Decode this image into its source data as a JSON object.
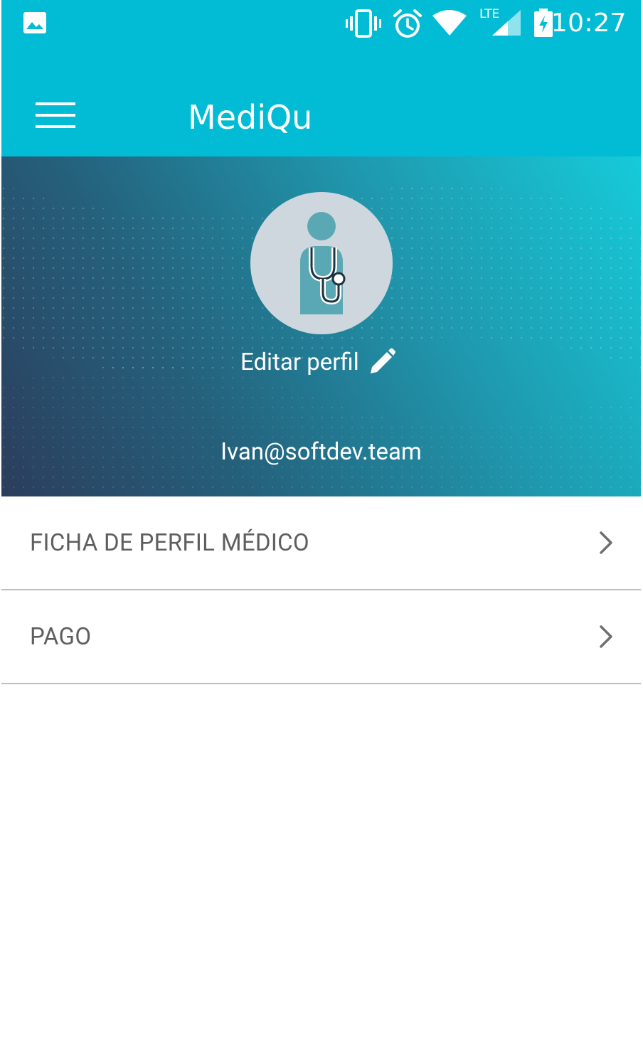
{
  "status_bar": {
    "time": "10:27",
    "network_label": "LTE",
    "icons": [
      "gallery-notification-icon",
      "vibrate-icon",
      "alarm-icon",
      "wifi-icon",
      "lte-signal-icon",
      "battery-charging-icon"
    ]
  },
  "app_bar": {
    "title": "MediQu",
    "menu_icon": "hamburger-menu-icon"
  },
  "profile": {
    "avatar_icon": "doctor-stethoscope-icon",
    "edit_label": "Editar perfil",
    "edit_icon": "pencil-icon",
    "email": "Ivan@softdev.team"
  },
  "menu": {
    "items": [
      {
        "label": "FICHA DE PERFIL MÉDICO",
        "icon": "chevron-right-icon"
      },
      {
        "label": "PAGO",
        "icon": "chevron-right-icon"
      }
    ]
  },
  "colors": {
    "primary": "#02bcd6",
    "header_gradient_start": "#2b3d5c",
    "header_gradient_end": "#16cbd9",
    "avatar_bg": "#cfd7de",
    "avatar_figure": "#5aa8b3",
    "menu_text": "#5e5e5e",
    "divider": "#bdbdbd"
  }
}
